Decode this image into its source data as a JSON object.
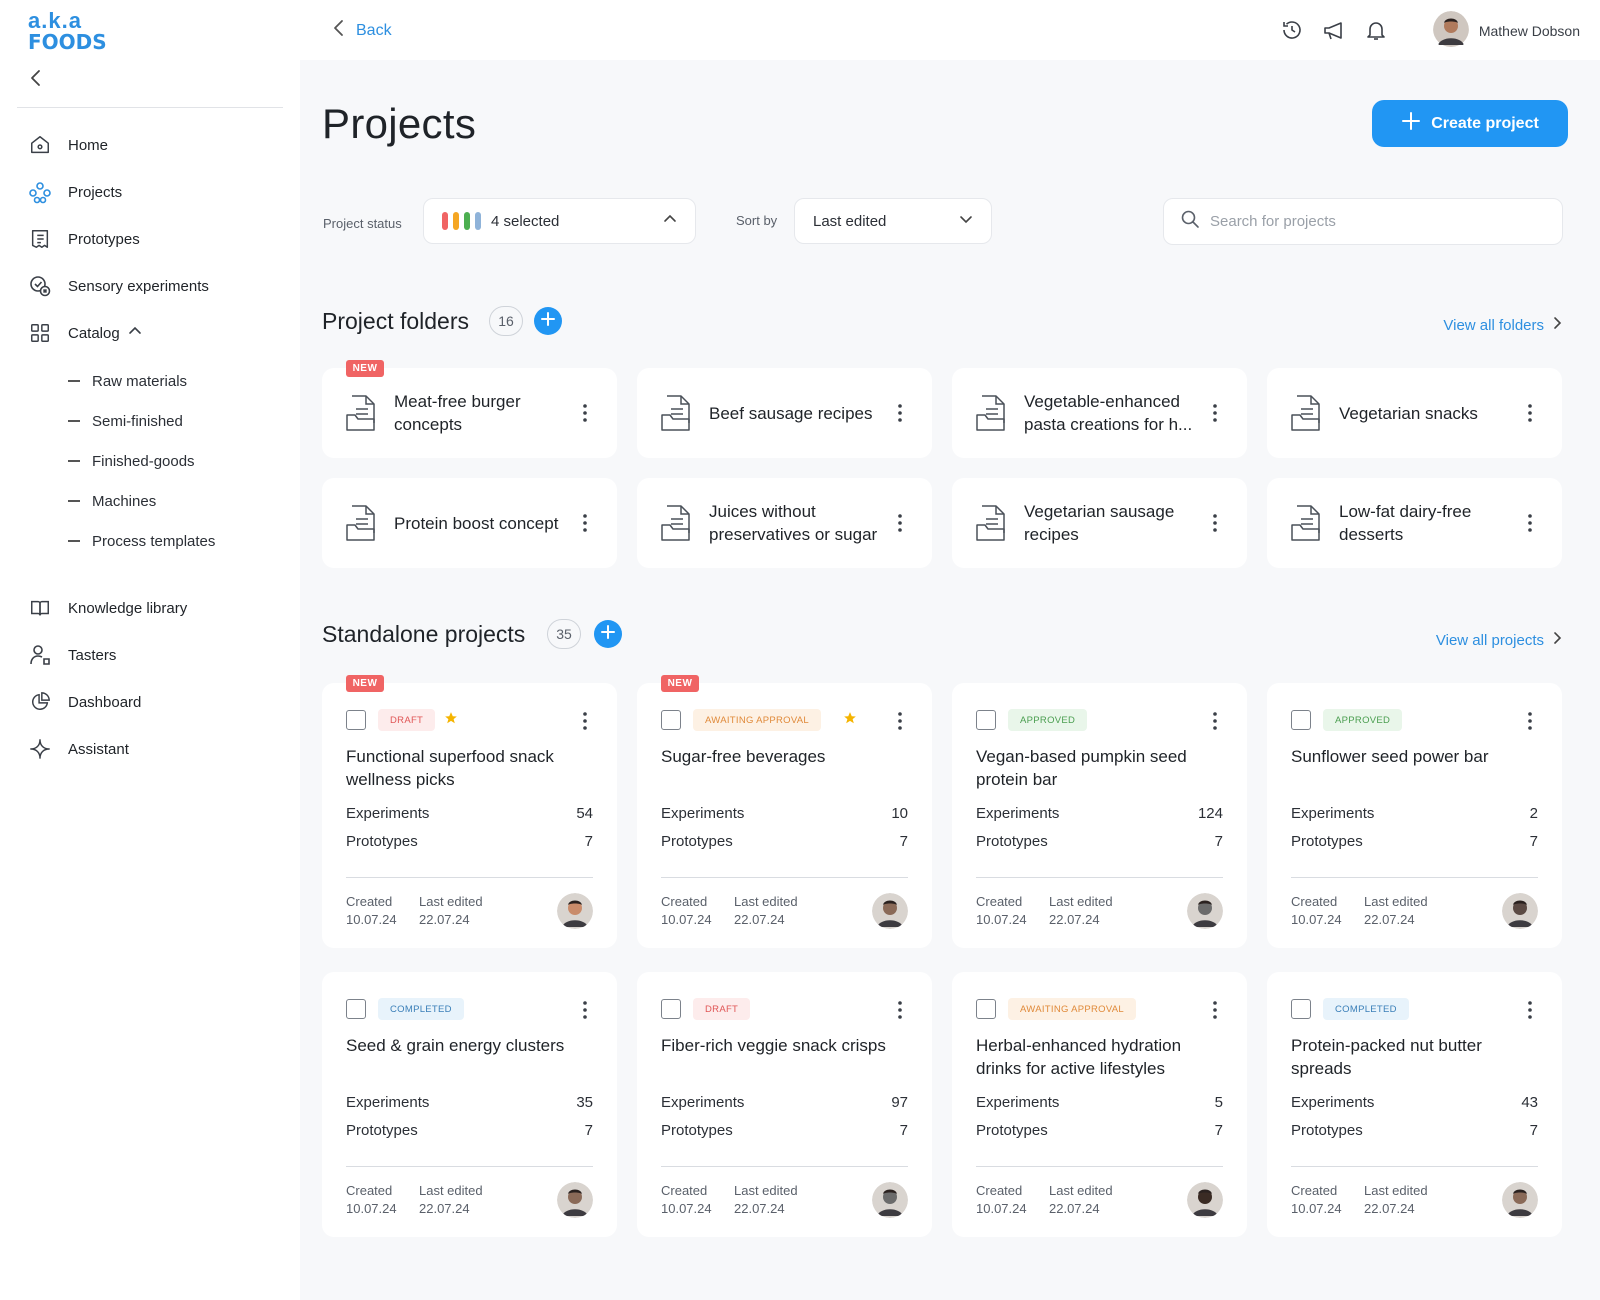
{
  "brand": {
    "line1": "a.k.a",
    "line2": "FOODS"
  },
  "sidebar": {
    "items": [
      {
        "label": "Home",
        "icon": "home-icon"
      },
      {
        "label": "Projects",
        "icon": "projects-icon"
      },
      {
        "label": "Prototypes",
        "icon": "prototypes-icon"
      },
      {
        "label": "Sensory experiments",
        "icon": "sensory-icon"
      },
      {
        "label": "Catalog",
        "icon": "catalog-icon"
      },
      {
        "label": "Knowledge library",
        "icon": "book-icon"
      },
      {
        "label": "Tasters",
        "icon": "tasters-icon"
      },
      {
        "label": "Dashboard",
        "icon": "dashboard-icon"
      },
      {
        "label": "Assistant",
        "icon": "sparkle-icon"
      }
    ],
    "catalog_sub": [
      "Raw materials",
      "Semi-finished",
      "Finished-goods",
      "Machines",
      "Process templates"
    ]
  },
  "topbar": {
    "back_label": "Back",
    "user_name": "Mathew Dobson"
  },
  "page": {
    "title": "Projects",
    "create_label": "Create project"
  },
  "filters": {
    "status_label": "Project status",
    "status_value": "4 selected",
    "status_colors": [
      "#f06464",
      "#f5a623",
      "#4caf50",
      "#8fb3d9"
    ],
    "sort_label": "Sort by",
    "sort_value": "Last edited",
    "search_placeholder": "Search for projects"
  },
  "folders": {
    "title": "Project folders",
    "count": "16",
    "view_all": "View all folders",
    "items": [
      {
        "name": "Meat-free burger concepts",
        "new": "NEW"
      },
      {
        "name": "Beef sausage recipes"
      },
      {
        "name": "Vegetable-enhanced pasta creations for h..."
      },
      {
        "name": "Vegetarian snacks"
      },
      {
        "name": "Protein boost concept"
      },
      {
        "name": "Juices without preservatives or sugar"
      },
      {
        "name": "Vegetarian sausage recipes"
      },
      {
        "name": "Low-fat dairy-free desserts"
      }
    ]
  },
  "standalone": {
    "title": "Standalone projects",
    "count": "35",
    "view_all": "View all projects",
    "labels": {
      "experiments": "Experiments",
      "prototypes": "Prototypes",
      "created": "Created",
      "last_edited": "Last edited"
    },
    "items": [
      {
        "new": "NEW",
        "status": "DRAFT",
        "status_class": "st-draft",
        "starred": true,
        "title": "Functional superfood snack wellness picks",
        "experiments": "54",
        "prototypes": "7",
        "created": "10.07.24",
        "edited": "22.07.24",
        "avatar": "#c98b6a"
      },
      {
        "new": "NEW",
        "status": "AWAITING APPROVAL",
        "status_class": "st-await",
        "starred": true,
        "title": "Sugar-free beverages",
        "experiments": "10",
        "prototypes": "7",
        "created": "10.07.24",
        "edited": "22.07.24",
        "avatar": "#8a6a58"
      },
      {
        "status": "APPROVED",
        "status_class": "st-approved",
        "title": "Vegan-based pumpkin seed protein bar",
        "experiments": "124",
        "prototypes": "7",
        "created": "10.07.24",
        "edited": "22.07.24",
        "avatar": "#6b6b6b"
      },
      {
        "status": "APPROVED",
        "status_class": "st-approved",
        "title": "Sunflower seed power bar",
        "experiments": "2",
        "prototypes": "7",
        "created": "10.07.24",
        "edited": "22.07.24",
        "avatar": "#5b4a44"
      },
      {
        "status": "COMPLETED",
        "status_class": "st-completed",
        "title": "Seed & grain energy clusters",
        "experiments": "35",
        "prototypes": "7",
        "created": "10.07.24",
        "edited": "22.07.24",
        "avatar": "#8a6a58"
      },
      {
        "status": "DRAFT",
        "status_class": "st-draft",
        "title": "Fiber-rich veggie snack crisps",
        "experiments": "97",
        "prototypes": "7",
        "created": "10.07.24",
        "edited": "22.07.24",
        "avatar": "#6b6b6b"
      },
      {
        "status": "AWAITING APPROVAL",
        "status_class": "st-await",
        "title": "Herbal-enhanced hydration drinks for active lifestyles",
        "experiments": "5",
        "prototypes": "7",
        "created": "10.07.24",
        "edited": "22.07.24",
        "avatar": "#3a2b24"
      },
      {
        "status": "COMPLETED",
        "status_class": "st-completed",
        "title": "Protein-packed nut butter spreads",
        "experiments": "43",
        "prototypes": "7",
        "created": "10.07.24",
        "edited": "22.07.24",
        "avatar": "#8a6a58"
      }
    ]
  }
}
